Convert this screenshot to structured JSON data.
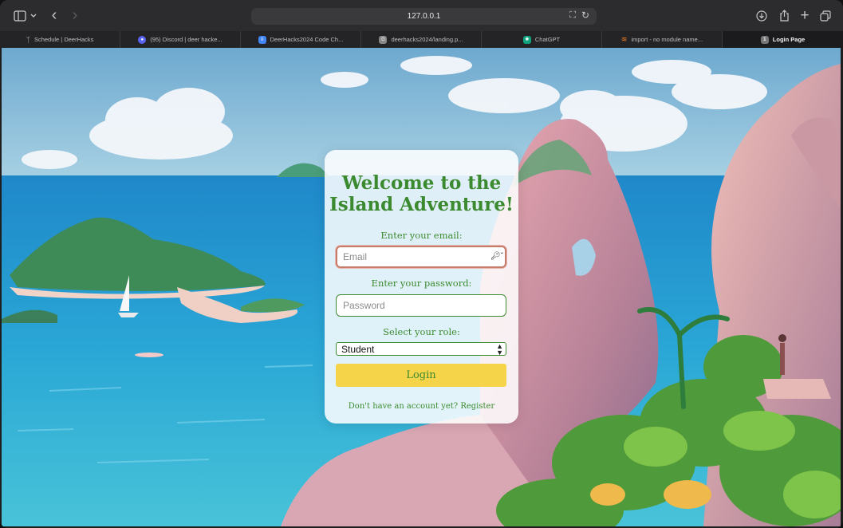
{
  "browser": {
    "address": "127.0.0.1",
    "tabs": [
      {
        "label": "Schedule | DeerHacks",
        "icon": "deer-icon"
      },
      {
        "label": "(95) Discord | deer hacke...",
        "icon": "discord-icon"
      },
      {
        "label": "DeerHacks2024 Code Ch...",
        "icon": "docs-icon"
      },
      {
        "label": "deerhacks2024/landing.p...",
        "icon": "github-icon"
      },
      {
        "label": "ChatGPT",
        "icon": "chatgpt-icon"
      },
      {
        "label": "import - no module name...",
        "icon": "stackoverflow-icon"
      },
      {
        "label": "Login Page",
        "icon": "page-icon",
        "active": true
      }
    ]
  },
  "login": {
    "title": "Welcome to the Island Adventure!",
    "email_label": "Enter your email:",
    "email_placeholder": "Email",
    "email_value": "",
    "password_label": "Enter your password:",
    "password_placeholder": "Password",
    "password_value": "",
    "role_label": "Select your role:",
    "role_selected": "Student",
    "login_button": "Login",
    "register_text": "Don't have an account yet? Register"
  },
  "colors": {
    "accent_green": "#3b8a2f",
    "button_yellow": "#f5d44a",
    "focus_ring": "#c77b6b"
  }
}
